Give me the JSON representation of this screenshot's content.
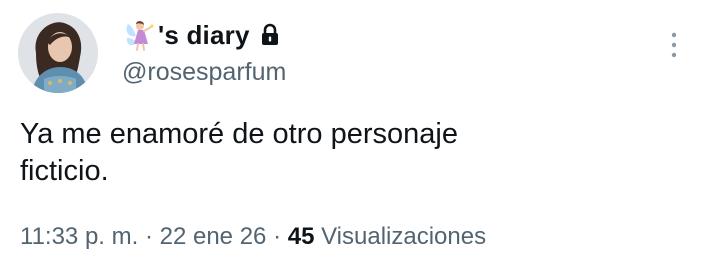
{
  "user": {
    "display_name": "'s diary",
    "handle": "@rosesparfum",
    "name_emoji_icon": "fairy-icon",
    "protected_icon": "lock-icon"
  },
  "tweet": {
    "text_line1": "Ya me enamoré de otro personaje",
    "text_line2": "ficticio."
  },
  "meta": {
    "time": "11:33 p. m.",
    "separator1": " · ",
    "date": "22 ene 26",
    "separator2": " · ",
    "views_count": "45",
    "views_label": " Visualizaciones"
  },
  "colors": {
    "text": "#0f1419",
    "secondary": "#536471"
  },
  "actions": {
    "more_icon": "more-vertical-icon"
  }
}
